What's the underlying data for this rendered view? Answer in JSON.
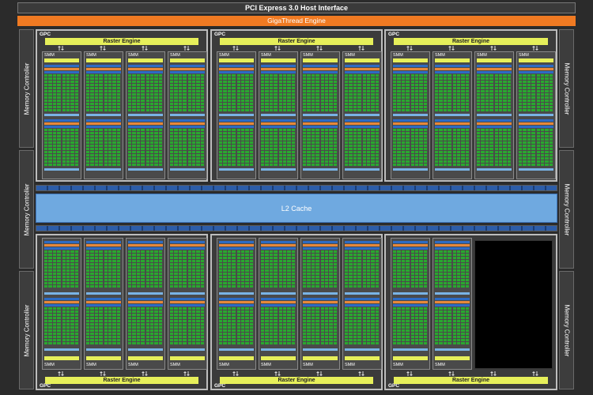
{
  "host_interface": "PCI Express 3.0 Host Interface",
  "thread_engine": "GigaThread Engine",
  "memory_controller_label": "Memory Controller",
  "l2_cache": "L2 Cache",
  "gpc_label": "GPC",
  "raster_engine_label": "Raster Engine",
  "smm_label": "SMM",
  "colors": {
    "background": "#2b2b2b",
    "giga_thread": "#f07a22",
    "raster_engine": "#e6ef5a",
    "cuda_core": "#29a82f",
    "l2_cache": "#6fa9e0",
    "register_blue": "#2d6bc4",
    "cache_orange": "#e6883a",
    "disabled_smm": "#000000"
  },
  "gpcs": [
    {
      "smm_count": 4,
      "disabled": false
    },
    {
      "smm_count": 4,
      "disabled": false
    },
    {
      "smm_count": 4,
      "disabled": false
    },
    {
      "smm_count": 4,
      "disabled": false
    },
    {
      "smm_count": 4,
      "disabled": false
    },
    {
      "smm_count": 2,
      "disabled": true
    }
  ]
}
